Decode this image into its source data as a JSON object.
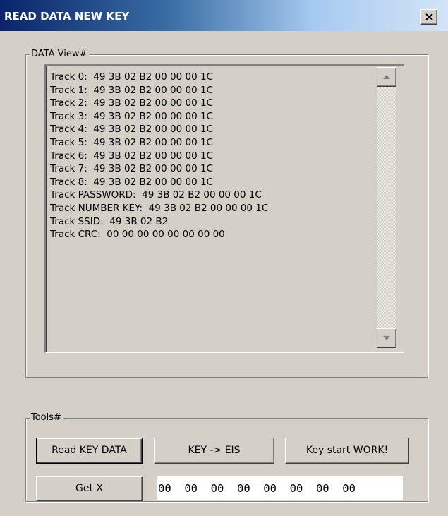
{
  "window": {
    "title": "READ DATA NEW KEY",
    "close_icon": "close-icon"
  },
  "data_view": {
    "label": "DATA View#",
    "tracks": [
      "Track 0:  49 3B 02 B2 00 00 00 1C",
      "Track 1:  49 3B 02 B2 00 00 00 1C",
      "Track 2:  49 3B 02 B2 00 00 00 1C",
      "Track 3:  49 3B 02 B2 00 00 00 1C",
      "Track 4:  49 3B 02 B2 00 00 00 1C",
      "Track 5:  49 3B 02 B2 00 00 00 1C",
      "Track 6:  49 3B 02 B2 00 00 00 1C",
      "Track 7:  49 3B 02 B2 00 00 00 1C",
      "Track 8:  49 3B 02 B2 00 00 00 1C",
      "Track PASSWORD:  49 3B 02 B2 00 00 00 1C",
      "Track NUMBER KEY:  49 3B 02 B2 00 00 00 1C",
      "Track SSID:  49 3B 02 B2",
      "Track CRC:  00 00 00 00 00 00 00 00"
    ],
    "scrollbar": {
      "up_icon": "scroll-up-arrow-icon",
      "down_icon": "scroll-down-arrow-icon"
    }
  },
  "tools": {
    "label": "Tools#",
    "read_key_label": "Read KEY DATA",
    "key_eis_label": "KEY -> EIS",
    "key_start_label": "Key start WORK!",
    "get_x_label": "Get X",
    "x_value": "00  00  00  00  00  00  00  00"
  },
  "colors": {
    "window_bg": "#d4d0c8",
    "title_start": "#0a246a",
    "title_end": "#a6caf0"
  }
}
